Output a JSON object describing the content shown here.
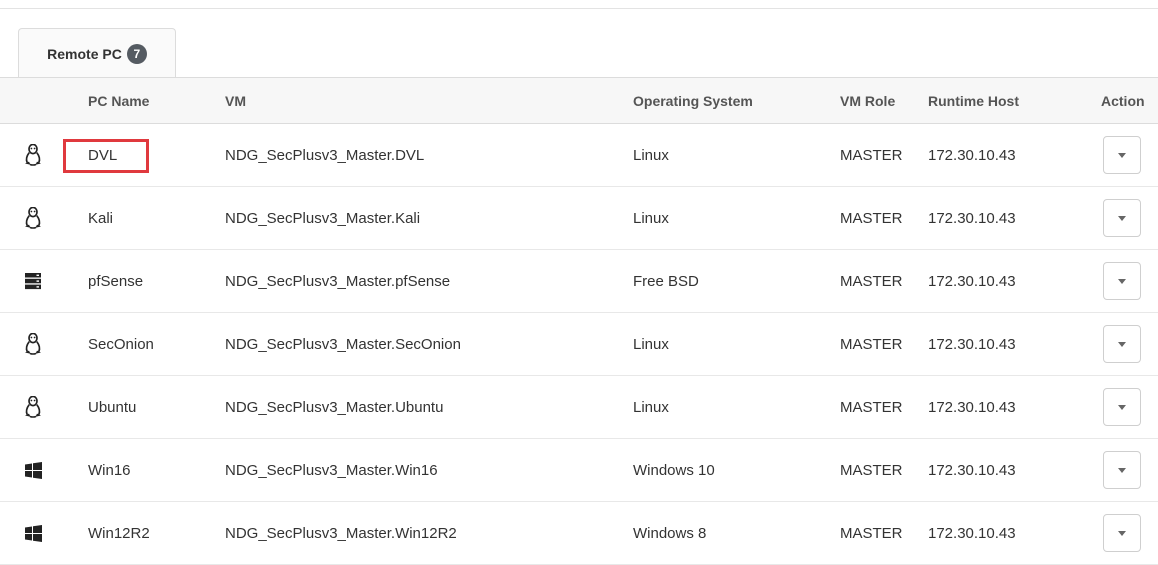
{
  "tab": {
    "label": "Remote PC",
    "count": "7"
  },
  "columns": {
    "pc_name": "PC Name",
    "vm": "VM",
    "os": "Operating System",
    "role": "VM Role",
    "host": "Runtime Host",
    "action": "Action"
  },
  "rows": [
    {
      "icon": "linux-icon",
      "name": "DVL",
      "vm": "NDG_SecPlusv3_Master.DVL",
      "os": "Linux",
      "role": "MASTER",
      "host": "172.30.10.43",
      "highlighted": true
    },
    {
      "icon": "linux-icon",
      "name": "Kali",
      "vm": "NDG_SecPlusv3_Master.Kali",
      "os": "Linux",
      "role": "MASTER",
      "host": "172.30.10.43"
    },
    {
      "icon": "server-icon",
      "name": "pfSense",
      "vm": "NDG_SecPlusv3_Master.pfSense",
      "os": "Free BSD",
      "role": "MASTER",
      "host": "172.30.10.43"
    },
    {
      "icon": "linux-icon",
      "name": "SecOnion",
      "vm": "NDG_SecPlusv3_Master.SecOnion",
      "os": "Linux",
      "role": "MASTER",
      "host": "172.30.10.43"
    },
    {
      "icon": "linux-icon",
      "name": "Ubuntu",
      "vm": "NDG_SecPlusv3_Master.Ubuntu",
      "os": "Linux",
      "role": "MASTER",
      "host": "172.30.10.43"
    },
    {
      "icon": "windows-icon",
      "name": "Win16",
      "vm": "NDG_SecPlusv3_Master.Win16",
      "os": "Windows 10",
      "role": "MASTER",
      "host": "172.30.10.43"
    },
    {
      "icon": "windows-icon",
      "name": "Win12R2",
      "vm": "NDG_SecPlusv3_Master.Win12R2",
      "os": "Windows 8",
      "role": "MASTER",
      "host": "172.30.10.43"
    }
  ],
  "colors": {
    "highlight": "#e0393e",
    "badge": "#555b62"
  }
}
